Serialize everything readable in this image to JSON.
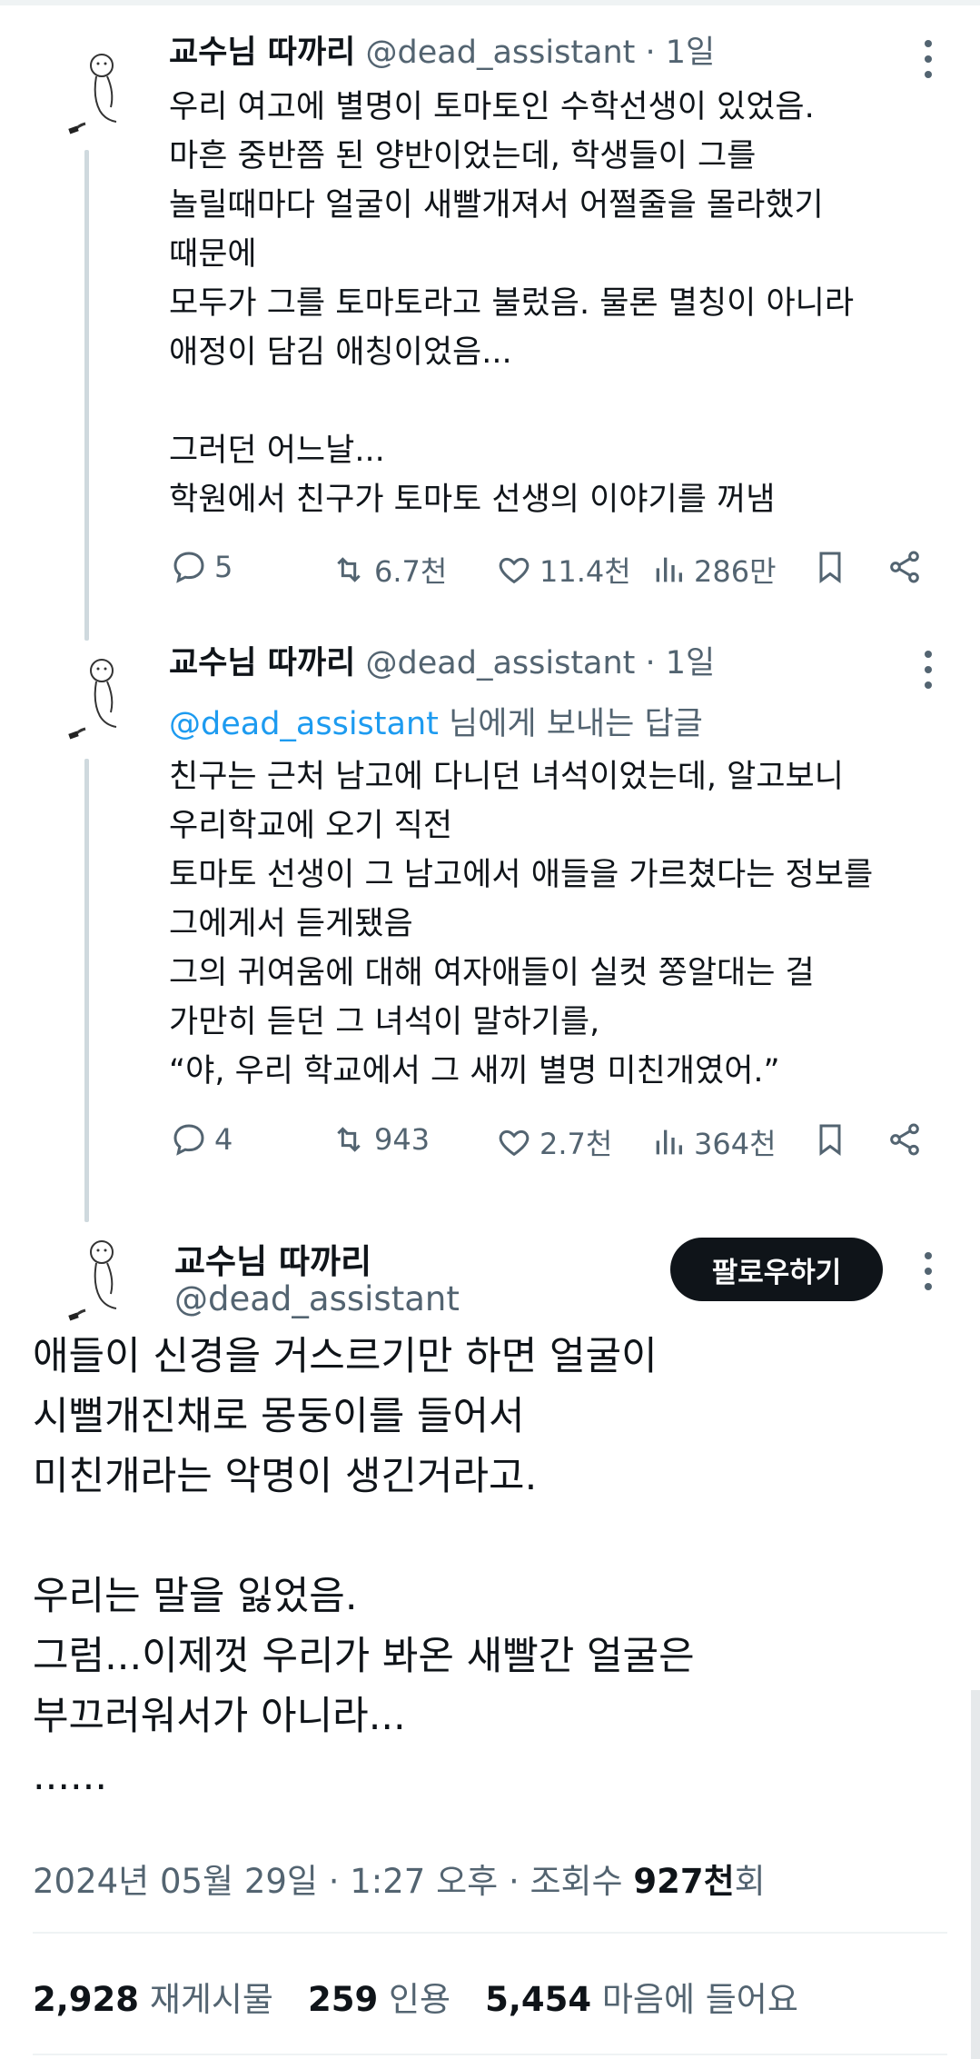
{
  "tweets": [
    {
      "name": "교수님 따까리",
      "handle": "@dead_assistant",
      "time": " · 1일",
      "lines": [
        "우리 여고에 별명이 토마토인 수학선생이 있었음.",
        "마흔 중반쯤 된 양반이었는데, 학생들이 그를",
        "놀릴때마다 얼굴이 새빨개져서 어쩔줄을 몰라했기",
        "때문에",
        "모두가 그를 토마토라고 불렀음. 물론 멸칭이 아니라",
        "애정이 담김 애칭이었음...",
        "",
        "그러던 어느날...",
        "학원에서 친구가 토마토 선생의 이야기를 꺼냄"
      ],
      "replies": "5",
      "retweets": "6.7천",
      "likes": "11.4천",
      "views": "286만"
    },
    {
      "name": "교수님 따까리",
      "handle": "@dead_assistant",
      "time": " · 1일",
      "reply_mention": "@dead_assistant",
      "reply_suffix": " 님에게 보내는 답글",
      "lines": [
        "친구는 근처 남고에 다니던 녀석이었는데, 알고보니",
        "우리학교에 오기 직전",
        "토마토 선생이 그 남고에서 애들을 가르쳤다는 정보를",
        "그에게서 듣게됐음",
        "그의 귀여움에 대해 여자애들이 실컷 쫑알대는 걸",
        "가만히 듣던 그 녀석이 말하기를,",
        "“야, 우리 학교에서 그 새끼 별명 미친개였어.”"
      ],
      "replies": "4",
      "retweets": "943",
      "likes": "2.7천",
      "views": "364천"
    }
  ],
  "main": {
    "name": "교수님 따까리",
    "handle": "@dead_assistant",
    "follow_label": "팔로우하기",
    "lines": [
      "애들이 신경을 거스르기만 하면 얼굴이",
      "시뻘개진채로 몽둥이를 들어서",
      "미친개라는 악명이 생긴거라고.",
      "",
      "우리는 말을 잃었음.",
      "그럼...이제껏 우리가 봐온 새빨간 얼굴은",
      "부끄러워서가 아니라...",
      "......"
    ],
    "timestamp": "2024년 05월 29일 · 1:27 오후 · 조회수 ",
    "views_count": "927천",
    "views_suffix": "회",
    "retweets_count": "2,928",
    "retweets_label": "재게시물",
    "quotes_count": "259",
    "quotes_label": "인용",
    "likes_count": "5,454",
    "likes_label": "마음에 들어요"
  },
  "icons": {
    "reply": "reply-icon",
    "retweet": "retweet-icon",
    "like": "heart-icon",
    "views": "views-icon",
    "bookmark": "bookmark-icon",
    "share": "share-icon",
    "more": "more-icon"
  },
  "colors": {
    "accent": "#1d9bf0",
    "text": "#0f1419",
    "muted": "#536471",
    "follow_button": "#0f1419"
  }
}
